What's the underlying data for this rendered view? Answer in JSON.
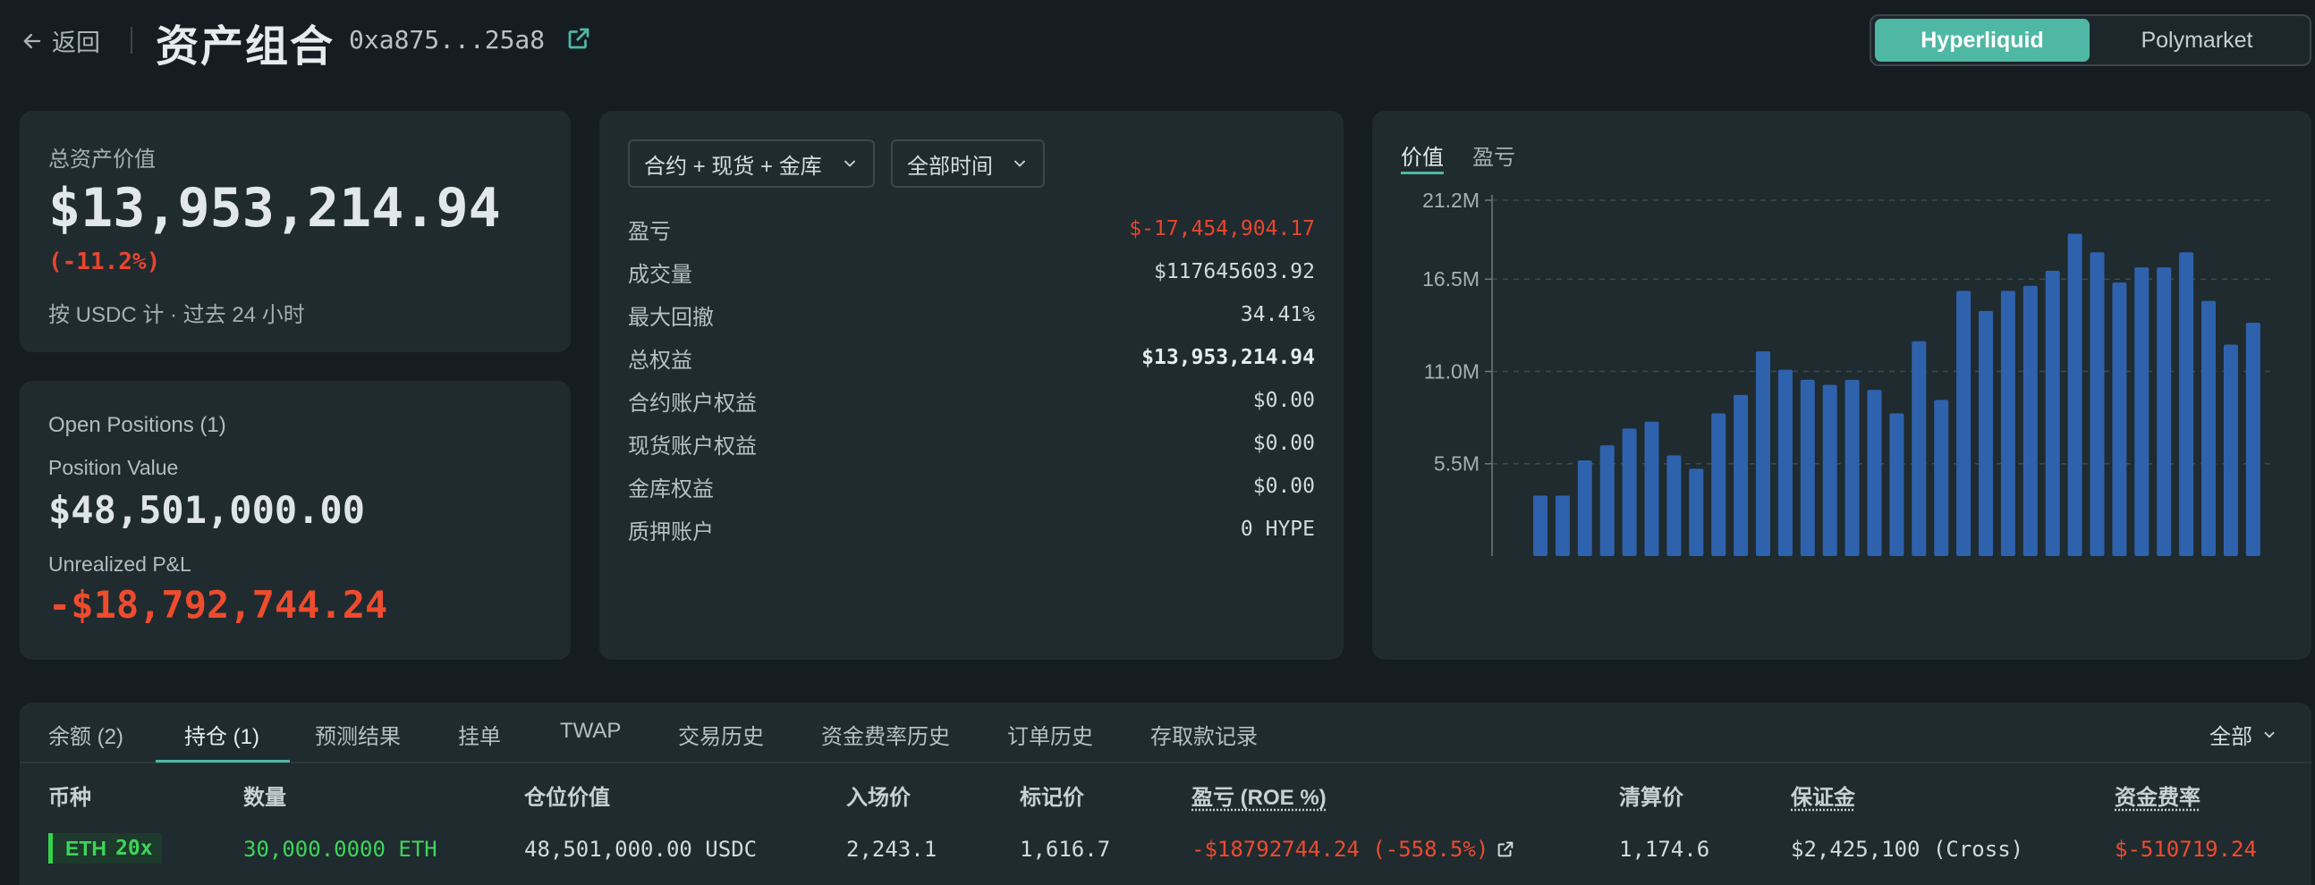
{
  "header": {
    "back_label": "返回",
    "title": "资产组合",
    "address": "0xa875...25a8",
    "platforms": [
      "Hyperliquid",
      "Polymarket"
    ],
    "active_platform": "Hyperliquid"
  },
  "summary": {
    "label": "总资产价值",
    "value": "$13,953,214.94",
    "change": "(-11.2%)",
    "note": "按 USDC 计 · 过去 24 小时"
  },
  "positions_card": {
    "title": "Open Positions (1)",
    "position_value_label": "Position Value",
    "position_value": "$48,501,000.00",
    "unrealized_label": "Unrealized P&L",
    "unrealized_value": "-$18,792,744.24"
  },
  "stats": {
    "scope_dropdown": "合约 + 现货 + 金库",
    "time_dropdown": "全部时间",
    "rows": [
      {
        "label": "盈亏",
        "value": "$-17,454,904.17"
      },
      {
        "label": "成交量",
        "value": "$117645603.92"
      },
      {
        "label": "最大回撤",
        "value": "34.41%"
      },
      {
        "label": "总权益",
        "value": "$13,953,214.94"
      },
      {
        "label": "合约账户权益",
        "value": "$0.00"
      },
      {
        "label": "现货账户权益",
        "value": "$0.00"
      },
      {
        "label": "金库权益",
        "value": "$0.00"
      },
      {
        "label": "质押账户",
        "value": "0 HYPE"
      }
    ]
  },
  "chart_tabs": [
    "价值",
    "盈亏"
  ],
  "chart_data": {
    "type": "bar",
    "title": "",
    "xlabel": "",
    "ylabel": "",
    "ytick_labels": [
      "21.2M",
      "16.5M",
      "11.0M",
      "5.5M"
    ],
    "ytick_values": [
      21.2,
      16.5,
      11.0,
      5.5
    ],
    "ylim": [
      0,
      21.2
    ],
    "unit": "M",
    "grid": true,
    "bar_color": "#2f62ad",
    "values": [
      3.6,
      3.6,
      5.7,
      6.6,
      7.6,
      8.0,
      6.0,
      5.2,
      8.5,
      9.6,
      12.2,
      11.1,
      10.5,
      10.2,
      10.5,
      9.9,
      8.5,
      12.8,
      9.3,
      15.8,
      14.6,
      15.8,
      16.1,
      17.0,
      19.2,
      18.1,
      16.3,
      17.2,
      17.2,
      18.1,
      15.2,
      12.6,
      13.9
    ]
  },
  "bottom": {
    "tabs": [
      "余额 (2)",
      "持仓 (1)",
      "预测结果",
      "挂单",
      "TWAP",
      "交易历史",
      "资金费率历史",
      "订单历史",
      "存取款记录"
    ],
    "active_tab": "持仓 (1)",
    "filter_label": "全部",
    "columns": [
      "币种",
      "数量",
      "仓位价值",
      "入场价",
      "标记价",
      "盈亏 (ROE %)",
      "清算价",
      "保证金",
      "资金费率"
    ],
    "row": {
      "coin": "ETH",
      "leverage": "20x",
      "size": "30,000.0000 ETH",
      "value": "48,501,000.00 USDC",
      "entry": "2,243.1",
      "mark": "1,616.7",
      "pnl": "-$18792744.24 (-558.5%)",
      "liq": "1,174.6",
      "margin": "$2,425,100 (Cross)",
      "funding": "$-510719.24"
    }
  },
  "colors": {
    "background": "#151d22",
    "card": "#1f2b2f",
    "accent": "#4fb8a4",
    "negative": "#e8462e",
    "positive": "#3fd45a"
  }
}
